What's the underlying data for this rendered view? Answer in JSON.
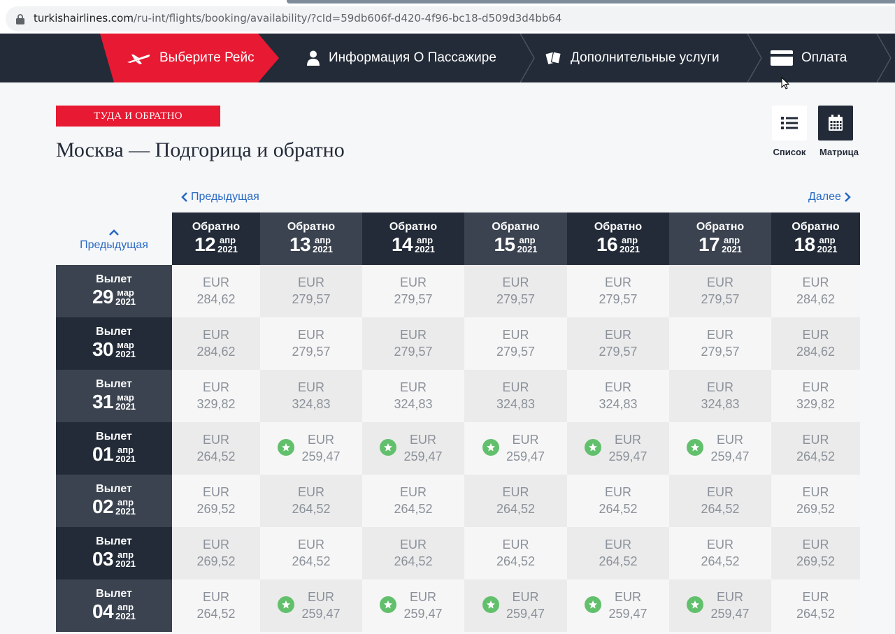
{
  "browser": {
    "url_host": "turkishairlines.com",
    "url_path": "/ru-int/flights/booking/availability/?cId=59db606f-d420-4f96-bc18-d509d3d4bb64"
  },
  "steps": [
    {
      "label": "Выберите Рейс",
      "icon": "plane-icon",
      "active": true
    },
    {
      "label": "Информация О Пассажире",
      "icon": "person-icon",
      "active": false
    },
    {
      "label": "Дополнительные услуги",
      "icon": "tickets-icon",
      "active": false
    },
    {
      "label": "Оплата",
      "icon": "card-icon",
      "active": false
    }
  ],
  "trip_type": "ТУДА И ОБРАТНО",
  "route_title": "Москва — Подгорица и обратно",
  "views": {
    "list": "Список",
    "matrix": "Матрица"
  },
  "nav": {
    "prev_cols": "Предыдущая",
    "next_cols": "Далее",
    "prev_rows": "Предыдущая"
  },
  "colors": {
    "brand_red": "#e81932",
    "navy": "#232b38",
    "slate": "#3b4350",
    "link": "#2a6ac4",
    "star": "#62c06d"
  },
  "matrix": {
    "return_label": "Обратно",
    "depart_label": "Вылет",
    "currency": "EUR",
    "columns": [
      {
        "day": "12",
        "mon": "апр",
        "year": "2021"
      },
      {
        "day": "13",
        "mon": "апр",
        "year": "2021"
      },
      {
        "day": "14",
        "mon": "апр",
        "year": "2021"
      },
      {
        "day": "15",
        "mon": "апр",
        "year": "2021"
      },
      {
        "day": "16",
        "mon": "апр",
        "year": "2021"
      },
      {
        "day": "17",
        "mon": "апр",
        "year": "2021"
      },
      {
        "day": "18",
        "mon": "апр",
        "year": "2021"
      }
    ],
    "rows": [
      {
        "day": "29",
        "mon": "мар",
        "year": "2021",
        "prices": [
          "284,62",
          "279,57",
          "279,57",
          "279,57",
          "279,57",
          "279,57",
          "284,62"
        ],
        "best": [
          false,
          false,
          false,
          false,
          false,
          false,
          false
        ]
      },
      {
        "day": "30",
        "mon": "мар",
        "year": "2021",
        "prices": [
          "284,62",
          "279,57",
          "279,57",
          "279,57",
          "279,57",
          "279,57",
          "284,62"
        ],
        "best": [
          false,
          false,
          false,
          false,
          false,
          false,
          false
        ]
      },
      {
        "day": "31",
        "mon": "мар",
        "year": "2021",
        "prices": [
          "329,82",
          "324,83",
          "324,83",
          "324,83",
          "324,83",
          "324,83",
          "329,82"
        ],
        "best": [
          false,
          false,
          false,
          false,
          false,
          false,
          false
        ]
      },
      {
        "day": "01",
        "mon": "апр",
        "year": "2021",
        "prices": [
          "264,52",
          "259,47",
          "259,47",
          "259,47",
          "259,47",
          "259,47",
          "264,52"
        ],
        "best": [
          false,
          true,
          true,
          true,
          true,
          true,
          false
        ]
      },
      {
        "day": "02",
        "mon": "апр",
        "year": "2021",
        "prices": [
          "269,52",
          "264,52",
          "264,52",
          "264,52",
          "264,52",
          "264,52",
          "269,52"
        ],
        "best": [
          false,
          false,
          false,
          false,
          false,
          false,
          false
        ]
      },
      {
        "day": "03",
        "mon": "апр",
        "year": "2021",
        "prices": [
          "269,52",
          "264,52",
          "264,52",
          "264,52",
          "264,52",
          "264,52",
          "269,52"
        ],
        "best": [
          false,
          false,
          false,
          false,
          false,
          false,
          false
        ]
      },
      {
        "day": "04",
        "mon": "апр",
        "year": "2021",
        "prices": [
          "264,52",
          "259,47",
          "259,47",
          "259,47",
          "259,47",
          "259,47",
          "264,52"
        ],
        "best": [
          false,
          true,
          true,
          true,
          true,
          true,
          false
        ]
      }
    ]
  }
}
